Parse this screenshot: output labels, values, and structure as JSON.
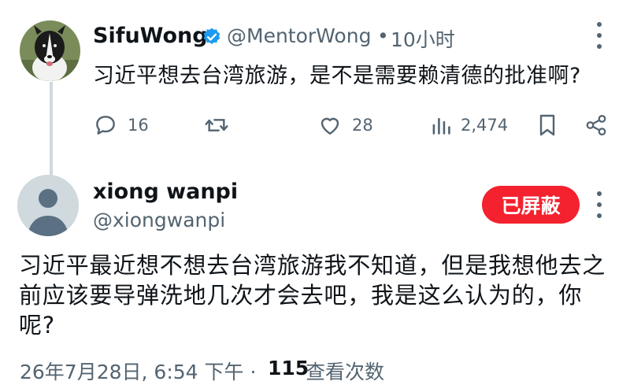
{
  "tweet": {
    "author_name": "SifuWong",
    "handle": "@MentorWong",
    "separator": "•",
    "time": "10小时",
    "text": "习近平想去台湾旅游，是不是需要赖清德的批准啊?",
    "actions": {
      "replies": "16",
      "likes": "28",
      "views": "2,474"
    }
  },
  "reply": {
    "author_name": "xiong wanpi",
    "handle": "@xiongwanpi",
    "blocked_label": "已屏蔽",
    "text": "习近平最近想不想去台湾旅游我不知道，但是我想他去之前应该要导弹洗地几次才会去吧，我是这么认为的，你呢?",
    "date": "26年7月28日, 6:54 下午 ·",
    "view_count": "115",
    "view_label": "查看次数"
  },
  "colors": {
    "verified": "#1d9bf0",
    "blocked_button": "#f4212e",
    "secondary_text": "#536471",
    "primary_text": "#0f1419"
  },
  "icons": [
    "verified-badge-icon",
    "more-icon",
    "reply-icon",
    "retweet-icon",
    "like-icon",
    "views-icon",
    "bookmark-icon",
    "share-icon",
    "default-avatar-icon"
  ]
}
